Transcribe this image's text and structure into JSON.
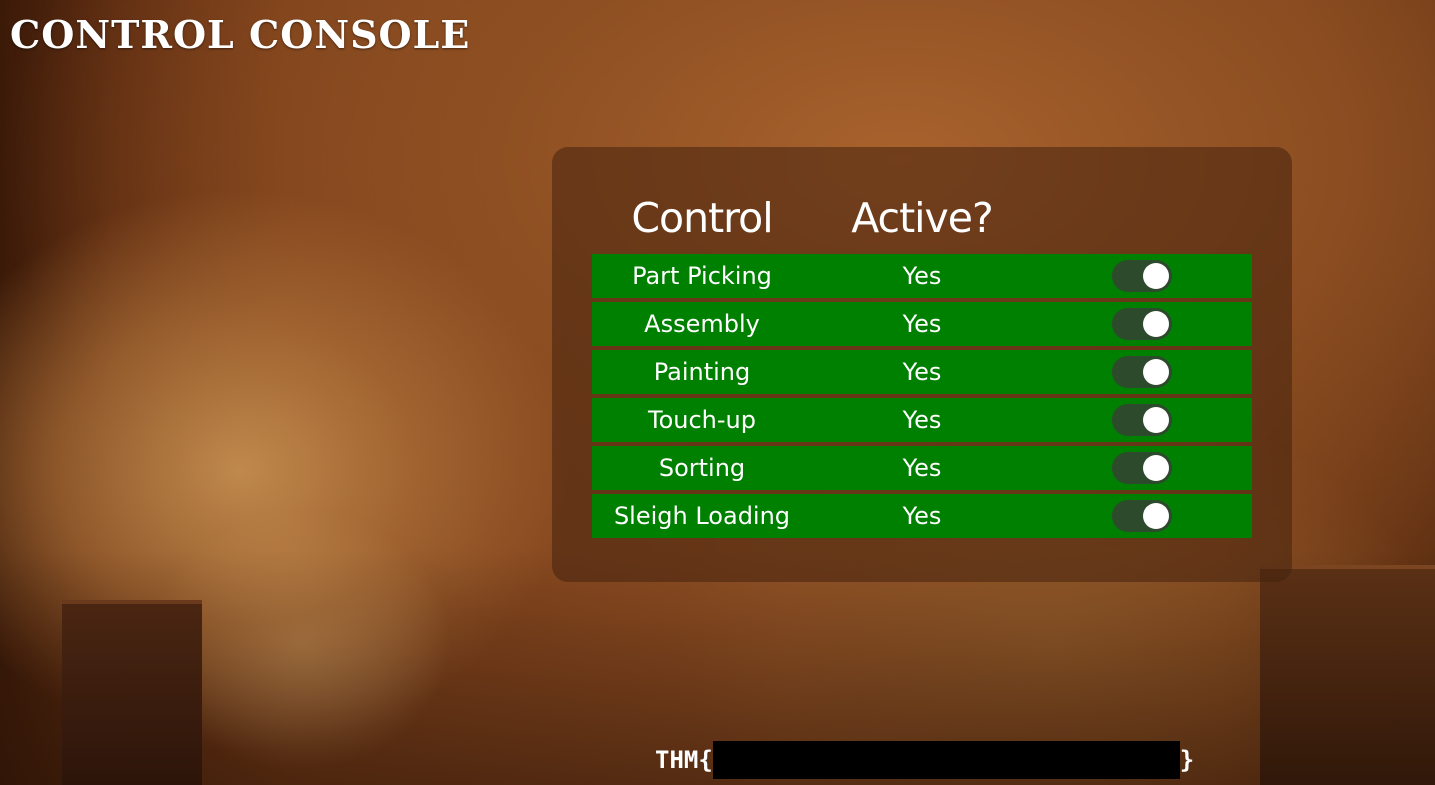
{
  "page": {
    "title": "CONTROL CONSOLE"
  },
  "table": {
    "headers": {
      "control": "Control",
      "active": "Active?"
    },
    "rows": [
      {
        "control": "Part Picking",
        "active": "Yes",
        "toggle_on": true
      },
      {
        "control": "Assembly",
        "active": "Yes",
        "toggle_on": true
      },
      {
        "control": "Painting",
        "active": "Yes",
        "toggle_on": true
      },
      {
        "control": "Touch-up",
        "active": "Yes",
        "toggle_on": true
      },
      {
        "control": "Sorting",
        "active": "Yes",
        "toggle_on": true
      },
      {
        "control": "Sleigh Loading",
        "active": "Yes",
        "toggle_on": true
      }
    ]
  },
  "flag": {
    "prefix": "THM{",
    "suffix": "}"
  },
  "colors": {
    "row_background": "#008000",
    "toggle_track": "#2d4a2d",
    "toggle_knob": "#ffffff",
    "panel": "rgba(70,35,15,0.55)"
  }
}
